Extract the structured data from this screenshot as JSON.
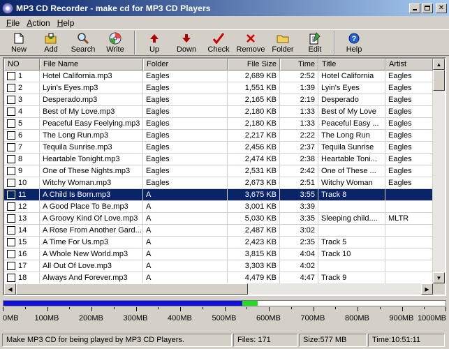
{
  "window": {
    "title": "MP3 CD Recorder - make cd for MP3 CD Players"
  },
  "menu": [
    "File",
    "Action",
    "Help"
  ],
  "toolbar": [
    {
      "label": "New",
      "icon": "new-file-icon"
    },
    {
      "label": "Add",
      "icon": "add-icon"
    },
    {
      "label": "Search",
      "icon": "search-icon"
    },
    {
      "label": "Write",
      "icon": "write-disc-icon"
    },
    {
      "label": "Up",
      "icon": "arrow-up-icon"
    },
    {
      "label": "Down",
      "icon": "arrow-down-icon"
    },
    {
      "label": "Check",
      "icon": "check-icon"
    },
    {
      "label": "Remove",
      "icon": "remove-icon"
    },
    {
      "label": "Folder",
      "icon": "folder-icon"
    },
    {
      "label": "Edit",
      "icon": "edit-icon"
    },
    {
      "label": "Help",
      "icon": "help-icon"
    }
  ],
  "list": {
    "columns": [
      "NO",
      "File Name",
      "Folder",
      "File Size",
      "Time",
      "Title",
      "Artist"
    ],
    "rows": [
      {
        "no": "1",
        "file": "Hotel California.mp3",
        "folder": "Eagles",
        "size": "2,689 KB",
        "time": "2:52",
        "title": "Hotel California",
        "artist": "Eagles"
      },
      {
        "no": "2",
        "file": "Lyin's Eyes.mp3",
        "folder": "Eagles",
        "size": "1,551 KB",
        "time": "1:39",
        "title": "Lyin's Eyes",
        "artist": "Eagles"
      },
      {
        "no": "3",
        "file": "Desperado.mp3",
        "folder": "Eagles",
        "size": "2,165 KB",
        "time": "2:19",
        "title": "Desperado",
        "artist": "Eagles"
      },
      {
        "no": "4",
        "file": "Best of My Love.mp3",
        "folder": "Eagles",
        "size": "2,180 KB",
        "time": "1:33",
        "title": "Best of My Love",
        "artist": "Eagles"
      },
      {
        "no": "5",
        "file": "Peaceful Easy Feelying.mp3",
        "folder": "Eagles",
        "size": "2,180 KB",
        "time": "1:33",
        "title": "Peaceful Easy ...",
        "artist": "Eagles"
      },
      {
        "no": "6",
        "file": "The Long Run.mp3",
        "folder": "Eagles",
        "size": "2,217 KB",
        "time": "2:22",
        "title": "The Long Run",
        "artist": "Eagles"
      },
      {
        "no": "7",
        "file": "Tequila Sunrise.mp3",
        "folder": "Eagles",
        "size": "2,456 KB",
        "time": "2:37",
        "title": "Tequila Sunrise",
        "artist": "Eagles"
      },
      {
        "no": "8",
        "file": "Heartable Tonight.mp3",
        "folder": "Eagles",
        "size": "2,474 KB",
        "time": "2:38",
        "title": "Heartable Toni...",
        "artist": "Eagles"
      },
      {
        "no": "9",
        "file": "One of These Nights.mp3",
        "folder": "Eagles",
        "size": "2,531 KB",
        "time": "2:42",
        "title": "One of These ...",
        "artist": "Eagles"
      },
      {
        "no": "10",
        "file": "Witchy Woman.mp3",
        "folder": "Eagles",
        "size": "2,673 KB",
        "time": "2:51",
        "title": "Witchy Woman",
        "artist": "Eagles"
      },
      {
        "no": "11",
        "file": "A Child Is Born.mp3",
        "folder": "A",
        "size": "3,675 KB",
        "time": "3:55",
        "title": "Track 8",
        "artist": "",
        "selected": true
      },
      {
        "no": "12",
        "file": "A Good Place To Be.mp3",
        "folder": "A",
        "size": "3,001 KB",
        "time": "3:39",
        "title": "",
        "artist": ""
      },
      {
        "no": "13",
        "file": "A Groovy Kind Of Love.mp3",
        "folder": "A",
        "size": "5,030 KB",
        "time": "3:35",
        "title": "Sleeping child....",
        "artist": "MLTR"
      },
      {
        "no": "14",
        "file": "A Rose From Another Gard...",
        "folder": "A",
        "size": "2,487 KB",
        "time": "3:02",
        "title": "",
        "artist": ""
      },
      {
        "no": "15",
        "file": "A Time For Us.mp3",
        "folder": "A",
        "size": "2,423 KB",
        "time": "2:35",
        "title": "Track 5",
        "artist": ""
      },
      {
        "no": "16",
        "file": "A Whole New World.mp3",
        "folder": "A",
        "size": "3,815 KB",
        "time": "4:04",
        "title": "Track 10",
        "artist": ""
      },
      {
        "no": "17",
        "file": "All Out Of Love.mp3",
        "folder": "A",
        "size": "3,303 KB",
        "time": "4:02",
        "title": "",
        "artist": ""
      },
      {
        "no": "18",
        "file": "Always And Forever.mp3",
        "folder": "A",
        "size": "4,479 KB",
        "time": "4:47",
        "title": "Track 9",
        "artist": ""
      }
    ]
  },
  "capacity": {
    "scale_labels": [
      "0MB",
      "100MB",
      "200MB",
      "300MB",
      "400MB",
      "500MB",
      "600MB",
      "700MB",
      "800MB",
      "900MB",
      "1000MB"
    ],
    "used_fraction": 0.54,
    "extra_fraction": 0.035,
    "used_color": "#1010d8",
    "extra_color": "#22dd22"
  },
  "status": {
    "message": "Make MP3 CD for being played by MP3 CD Players.",
    "files": "Files: 171",
    "size": "Size:577 MB",
    "time": "Time:10:51:11"
  }
}
